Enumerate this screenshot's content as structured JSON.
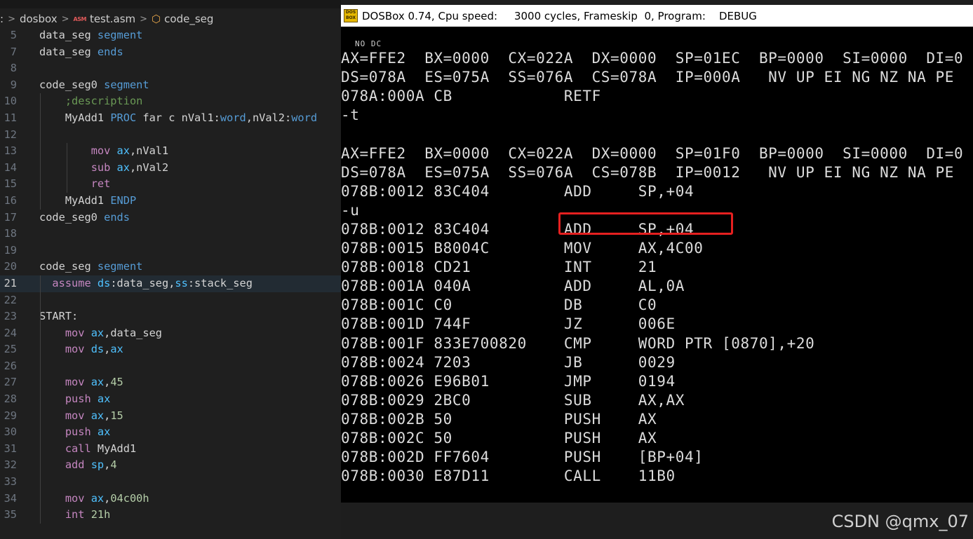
{
  "breadcrumb": {
    "items": [
      ":",
      "dosbox",
      "test.asm",
      "code_seg"
    ],
    "file_icon_text": "ASM"
  },
  "editor": {
    "active_line": "21",
    "lines": [
      {
        "n": "5",
        "t": [
          [
            "data_seg ",
            "t-txt"
          ],
          [
            "segment",
            "t-kw"
          ]
        ]
      },
      {
        "n": "7",
        "t": [
          [
            "data_seg ",
            "t-txt"
          ],
          [
            "ends",
            "t-kw"
          ]
        ]
      },
      {
        "n": "8",
        "t": []
      },
      {
        "n": "9",
        "t": [
          [
            "code_seg0 ",
            "t-txt"
          ],
          [
            "segment",
            "t-kw"
          ]
        ]
      },
      {
        "n": "10",
        "t": [
          [
            "    ",
            "t-txt"
          ],
          [
            ";description",
            "t-cmt"
          ]
        ]
      },
      {
        "n": "11",
        "t": [
          [
            "    MyAdd1 ",
            "t-txt"
          ],
          [
            "PROC",
            "t-kw"
          ],
          [
            " far c nVal1:",
            "t-txt"
          ],
          [
            "word",
            "t-kw"
          ],
          [
            ",nVal2:",
            "t-txt"
          ],
          [
            "word",
            "t-kw"
          ]
        ]
      },
      {
        "n": "12",
        "t": []
      },
      {
        "n": "13",
        "t": [
          [
            "        ",
            "t-txt"
          ],
          [
            "mov ",
            "t-ins"
          ],
          [
            "ax",
            "t-reg"
          ],
          [
            ",nVal1",
            "t-txt"
          ]
        ]
      },
      {
        "n": "14",
        "t": [
          [
            "        ",
            "t-txt"
          ],
          [
            "sub ",
            "t-ins"
          ],
          [
            "ax",
            "t-reg"
          ],
          [
            ",nVal2",
            "t-txt"
          ]
        ]
      },
      {
        "n": "15",
        "t": [
          [
            "        ",
            "t-txt"
          ],
          [
            "ret",
            "t-ins"
          ]
        ]
      },
      {
        "n": "16",
        "t": [
          [
            "    MyAdd1 ",
            "t-txt"
          ],
          [
            "ENDP",
            "t-kw"
          ]
        ]
      },
      {
        "n": "17",
        "t": [
          [
            "code_seg0 ",
            "t-txt"
          ],
          [
            "ends",
            "t-kw"
          ]
        ]
      },
      {
        "n": "18",
        "t": []
      },
      {
        "n": "19",
        "t": []
      },
      {
        "n": "20",
        "t": [
          [
            "code_seg ",
            "t-txt"
          ],
          [
            "segment",
            "t-kw"
          ]
        ]
      },
      {
        "n": "21",
        "t": [
          [
            "  ",
            "t-txt"
          ],
          [
            "assume ",
            "t-ins"
          ],
          [
            "ds",
            "t-reg"
          ],
          [
            ":data_seg,",
            "t-txt"
          ],
          [
            "ss",
            "t-reg"
          ],
          [
            ":stack_seg",
            "t-txt"
          ]
        ]
      },
      {
        "n": "22",
        "t": []
      },
      {
        "n": "23",
        "t": [
          [
            "START:",
            "t-txt"
          ]
        ]
      },
      {
        "n": "24",
        "t": [
          [
            "    ",
            "t-txt"
          ],
          [
            "mov ",
            "t-ins"
          ],
          [
            "ax",
            "t-reg"
          ],
          [
            ",data_seg",
            "t-txt"
          ]
        ]
      },
      {
        "n": "25",
        "t": [
          [
            "    ",
            "t-txt"
          ],
          [
            "mov ",
            "t-ins"
          ],
          [
            "ds",
            "t-reg"
          ],
          [
            ",",
            "t-txt"
          ],
          [
            "ax",
            "t-reg"
          ]
        ]
      },
      {
        "n": "26",
        "t": []
      },
      {
        "n": "27",
        "t": [
          [
            "    ",
            "t-txt"
          ],
          [
            "mov ",
            "t-ins"
          ],
          [
            "ax",
            "t-reg"
          ],
          [
            ",",
            "t-txt"
          ],
          [
            "45",
            "t-num"
          ]
        ]
      },
      {
        "n": "28",
        "t": [
          [
            "    ",
            "t-txt"
          ],
          [
            "push ",
            "t-ins"
          ],
          [
            "ax",
            "t-reg"
          ]
        ]
      },
      {
        "n": "29",
        "t": [
          [
            "    ",
            "t-txt"
          ],
          [
            "mov ",
            "t-ins"
          ],
          [
            "ax",
            "t-reg"
          ],
          [
            ",",
            "t-txt"
          ],
          [
            "15",
            "t-num"
          ]
        ]
      },
      {
        "n": "30",
        "t": [
          [
            "    ",
            "t-txt"
          ],
          [
            "push ",
            "t-ins"
          ],
          [
            "ax",
            "t-reg"
          ]
        ]
      },
      {
        "n": "31",
        "t": [
          [
            "    ",
            "t-txt"
          ],
          [
            "call ",
            "t-ins"
          ],
          [
            "MyAdd1",
            "t-txt"
          ]
        ]
      },
      {
        "n": "32",
        "t": [
          [
            "    ",
            "t-txt"
          ],
          [
            "add ",
            "t-ins"
          ],
          [
            "sp",
            "t-reg"
          ],
          [
            ",",
            "t-txt"
          ],
          [
            "4",
            "t-num"
          ]
        ]
      },
      {
        "n": "33",
        "t": []
      },
      {
        "n": "34",
        "t": [
          [
            "    ",
            "t-txt"
          ],
          [
            "mov ",
            "t-ins"
          ],
          [
            "ax",
            "t-reg"
          ],
          [
            ",",
            "t-txt"
          ],
          [
            "04c00h",
            "t-num"
          ]
        ]
      },
      {
        "n": "35",
        "t": [
          [
            "    ",
            "t-txt"
          ],
          [
            "int ",
            "t-ins"
          ],
          [
            "21h",
            "t-num"
          ]
        ]
      }
    ]
  },
  "dosbox": {
    "title": "DOSBox 0.74, Cpu speed:     3000 cycles, Frameskip  0, Program:    DEBUG",
    "icon_text": "DOS BOX",
    "hint_text": "NO DC",
    "highlight_color": "#e52020",
    "cursor_text": "_▲",
    "lines": [
      "AX=FFE2  BX=0000  CX=022A  DX=0000  SP=01EC  BP=0000  SI=0000  DI=0",
      "DS=078A  ES=075A  SS=076A  CS=078A  IP=000A   NV UP EI NG NZ NA PE",
      "078A:000A CB            RETF",
      "-t",
      "",
      "AX=FFE2  BX=0000  CX=022A  DX=0000  SP=01F0  BP=0000  SI=0000  DI=0",
      "DS=078A  ES=075A  SS=076A  CS=078B  IP=0012   NV UP EI NG NZ NA PE",
      "078B:0012 83C404        ADD     SP,+04",
      "-u",
      "078B:0012 83C404        ADD     SP,+04",
      "078B:0015 B8004C        MOV     AX,4C00",
      "078B:0018 CD21          INT     21",
      "078B:001A 040A          ADD     AL,0A",
      "078B:001C C0            DB      C0",
      "078B:001D 744F          JZ      006E",
      "078B:001F 833E700820    CMP     WORD PTR [0870],+20",
      "078B:0024 7203          JB      0029",
      "078B:0026 E96B01        JMP     0194",
      "078B:0029 2BC0          SUB     AX,AX",
      "078B:002B 50            PUSH    AX",
      "078B:002C 50            PUSH    AX",
      "078B:002D FF7604        PUSH    [BP+04]",
      "078B:0030 E87D11        CALL    11B0"
    ]
  },
  "watermark": "CSDN @qmx_07"
}
